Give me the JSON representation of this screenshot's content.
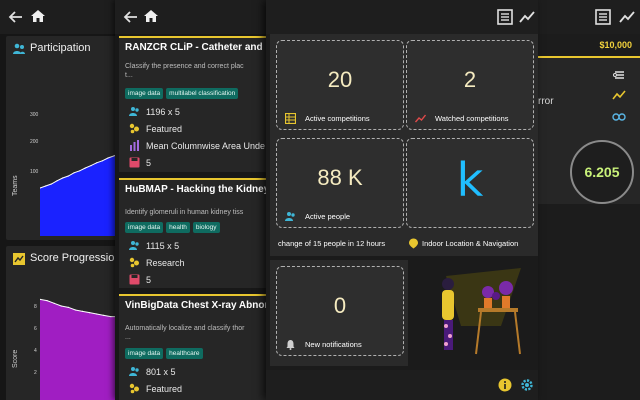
{
  "back": {
    "header_amount": "$10,000",
    "error_fragment": "rror",
    "rank_value": "6.205"
  },
  "charts": {
    "participation": {
      "title": "Participation",
      "ylabel": "Teams",
      "ticks": [
        "300",
        "200",
        "100"
      ],
      "chart_data": {
        "type": "area",
        "ylabel": "Teams",
        "ylim": [
          0,
          350
        ],
        "values": [
          120,
          125,
          130,
          138,
          145,
          150,
          158,
          163,
          170,
          176,
          183,
          188,
          195,
          200,
          206,
          212
        ]
      }
    },
    "score": {
      "title": "Score Progression",
      "ylabel": "Score",
      "ticks": [
        "8",
        "6",
        "4",
        "2"
      ],
      "chart_data": {
        "type": "area",
        "ylabel": "Score",
        "ylim": [
          0,
          9
        ],
        "values": [
          8.0,
          7.9,
          7.7,
          7.5,
          7.4,
          7.2,
          7.1,
          7.0,
          6.9,
          6.8,
          6.7,
          6.7,
          6.6
        ]
      }
    }
  },
  "competitions": [
    {
      "title": "RANZCR CLiP - Catheter and Li",
      "desc_lines": [
        "Classify the presence and correct plac",
        "t..."
      ],
      "tags": [
        "image data",
        "multilabel classification"
      ],
      "size": "1196 x 5",
      "category": "Featured",
      "metric": "Mean Columnwise Area Unde",
      "count": "5"
    },
    {
      "title": "HuBMAP - Hacking the Kidney",
      "desc_lines": [
        "Identify glomeruli in human kidney tiss"
      ],
      "tags": [
        "image data",
        "health",
        "biology"
      ],
      "size": "1115 x 5",
      "category": "Research",
      "count": "5"
    },
    {
      "title": "VinBigData Chest X-ray Abnorm",
      "desc_lines": [
        "Automatically localize and classify thor",
        "..."
      ],
      "tags": [
        "image data",
        "healthcare"
      ],
      "size": "801 x 5",
      "category": "Featured"
    }
  ],
  "dashboard": {
    "active_competitions": {
      "value": "20",
      "label": "Active competitions"
    },
    "watched_competitions": {
      "value": "2",
      "label": "Watched competitions"
    },
    "active_people": {
      "value": "88 K",
      "label": "Active people",
      "caption": "change of 15 people in 12 hours"
    },
    "kaggle_tile": {
      "value": "k",
      "caption": "Indoor Location & Navigation"
    },
    "notifications": {
      "value": "0",
      "label": "New notifications"
    }
  },
  "colors": {
    "accent_yellow": "#e8c62f",
    "chip_teal": "#0f6b60",
    "area_blue": "#1a22ff",
    "area_purple": "#a01ec2",
    "kaggle_blue": "#20beff"
  }
}
